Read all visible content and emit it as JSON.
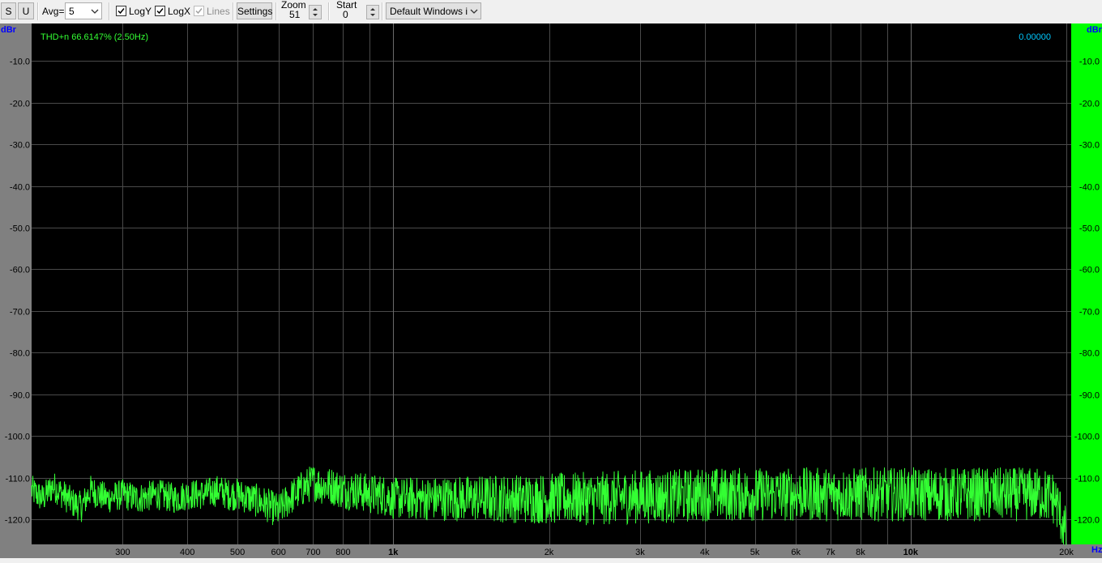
{
  "toolbar": {
    "s_label": "S",
    "u_label": "U",
    "avg_label": "Avg=",
    "avg_value": "5",
    "logy_label": "LogY",
    "logy_checked": true,
    "logx_label": "LogX",
    "logx_checked": true,
    "lines_label": "Lines",
    "lines_checked": true,
    "settings_label": "Settings",
    "zoom_label": "Zoom",
    "zoom_value": "51",
    "start_label": "Start",
    "start_value": "0",
    "device_value": "Default Windows inp"
  },
  "colors": {
    "trace": "#33ff33",
    "grid": "#4a4a4a",
    "grid_major": "#6a6a6a",
    "right_axis_bg": "#00ff00",
    "left_axis_bg": "#808080",
    "readout": "#00c8ff",
    "unit_text": "#0000ff"
  },
  "chart_data": {
    "type": "line",
    "status_text": "THD+n 66.6147% (2.50Hz)",
    "readout_value": "0.00000",
    "y_unit": "dBr",
    "x_unit": "Hz",
    "xscale": "log",
    "xlim": [
      200,
      20000
    ],
    "ylim": [
      -126,
      -1
    ],
    "grid": true,
    "y_ticks": [
      -10,
      -20,
      -30,
      -40,
      -50,
      -60,
      -70,
      -80,
      -90,
      -100,
      -110,
      -120
    ],
    "y_tick_labels": [
      "-10.0",
      "-20.0",
      "-30.0",
      "-40.0",
      "-50.0",
      "-60.0",
      "-70.0",
      "-80.0",
      "-90.0",
      "-100.0",
      "-110.0",
      "-120.0"
    ],
    "right_tick_labels": [
      "-10.0",
      "-20.0",
      "-30.0",
      "-40.0",
      "-50.0",
      "-60.0",
      "-70.0",
      "-80.0",
      "-90.0",
      "-100.0",
      "-110.0",
      "-120.0"
    ],
    "x_ticks": [
      300,
      400,
      500,
      600,
      700,
      800,
      1000,
      2000,
      3000,
      4000,
      5000,
      6000,
      7000,
      8000,
      10000,
      20000
    ],
    "x_tick_labels": [
      "300",
      "400",
      "500",
      "600",
      "700",
      "800",
      "1k",
      "2k",
      "3k",
      "4k",
      "5k",
      "6k",
      "7k",
      "8k",
      "10k",
      "20k"
    ],
    "x_minor_gridlines": [
      900,
      9000
    ],
    "series": [
      {
        "x": [
          200,
          210,
          220,
          230,
          240,
          250,
          260,
          280,
          300,
          320,
          350,
          380,
          400,
          430,
          460,
          480,
          500,
          530,
          560,
          600,
          630,
          660,
          700,
          730,
          760,
          800,
          850,
          900,
          950,
          1000,
          1200,
          1500,
          2000,
          2500,
          3000,
          3500,
          4000,
          4500,
          5000,
          6000,
          7000,
          8000,
          9000,
          10000,
          12000,
          14000,
          16000,
          18000,
          19000,
          19500,
          20000
        ],
        "y": [
          -113,
          -115,
          -112,
          -114,
          -116,
          -117,
          -113,
          -115,
          -114,
          -115,
          -114,
          -115,
          -114,
          -114,
          -113,
          -114,
          -114,
          -115,
          -116,
          -118,
          -115,
          -113,
          -111,
          -112,
          -112,
          -113,
          -113,
          -114,
          -114,
          -115,
          -115,
          -115,
          -115,
          -115,
          -114.5,
          -114.5,
          -114,
          -114,
          -114,
          -114,
          -114,
          -114,
          -114,
          -114,
          -114,
          -114,
          -114,
          -114,
          -115,
          -119,
          -124
        ]
      }
    ]
  }
}
